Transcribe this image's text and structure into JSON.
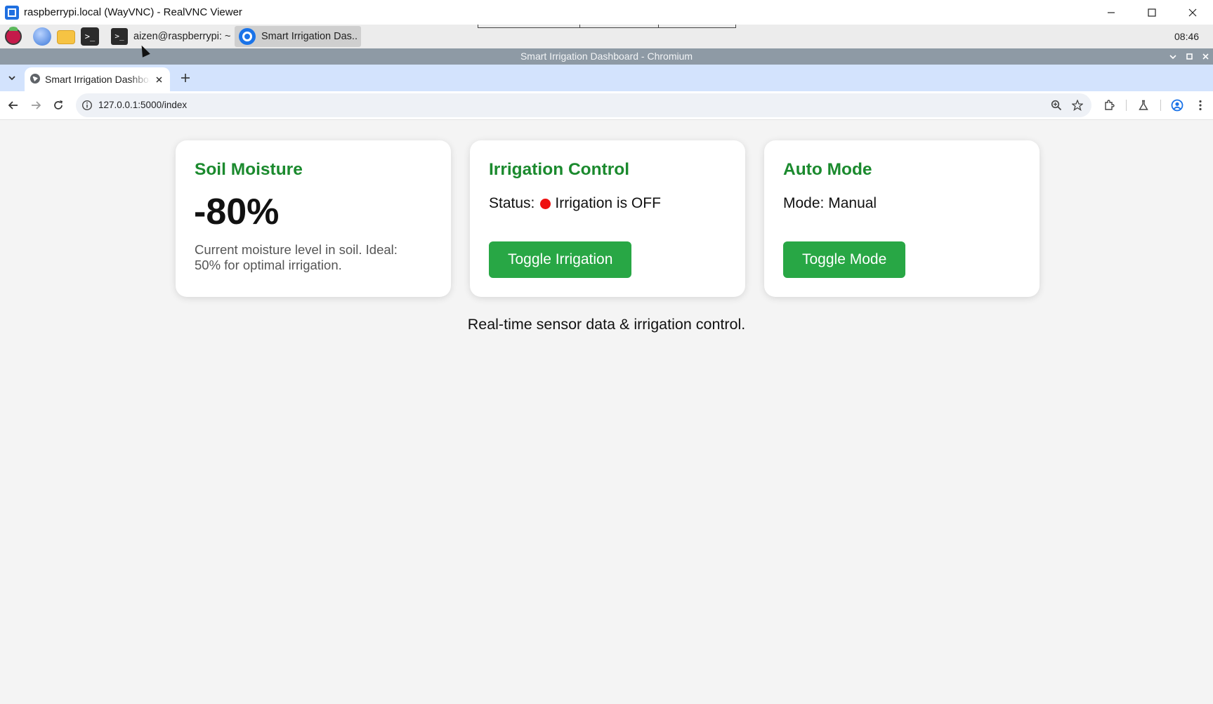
{
  "vnc_window": {
    "title": "raspberrypi.local (WayVNC) - RealVNC Viewer",
    "minimize_icon": "minimize-icon",
    "maximize_icon": "maximize-icon",
    "close_icon": "close-icon"
  },
  "taskbar": {
    "launchers": [
      "raspberry-pi-menu-icon",
      "web-browser-icon",
      "file-manager-icon",
      "terminal-icon"
    ],
    "terminal_glyph": ">_",
    "tasks": [
      {
        "label": "aizen@raspberrypi: ~",
        "icon": "terminal-icon"
      },
      {
        "label": "Smart Irrigation Das..",
        "icon": "chromium-icon"
      }
    ],
    "tray": [
      "sync-icon",
      "bluetooth-icon",
      "network-icon",
      "volume-icon"
    ],
    "clock": "08:46"
  },
  "chromium": {
    "window_title": "Smart Irrigation Dashboard - Chromium",
    "tab": {
      "title": "Smart Irrigation Dashboard"
    },
    "url": "127.0.0.1:5000/index"
  },
  "dashboard": {
    "soil": {
      "title": "Soil Moisture",
      "value": "-80%",
      "description": "Current moisture level in soil. Ideal: 50% for optimal irrigation."
    },
    "irrigation": {
      "title": "Irrigation Control",
      "status_label": "Status:",
      "status_text": "Irrigation is OFF",
      "status_color": "#ee1111",
      "button_label": "Toggle Irrigation"
    },
    "auto_mode": {
      "title": "Auto Mode",
      "mode_label": "Mode:",
      "mode_value": "Manual",
      "button_label": "Toggle Mode"
    },
    "footer": "Real-time sensor data & irrigation control."
  },
  "colors": {
    "accent_green": "#1b8a2e",
    "button_green": "#28a745",
    "tab_strip": "#d3e3fd",
    "chrome_titlebar": "#8e9aa5"
  }
}
